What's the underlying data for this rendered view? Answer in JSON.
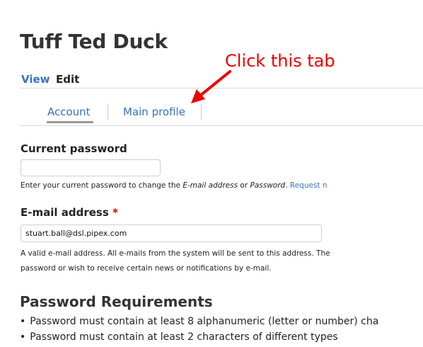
{
  "page": {
    "title": "Tuff Ted Duck"
  },
  "primary_tabs": [
    {
      "label": "View"
    },
    {
      "label": "Edit"
    }
  ],
  "secondary_tabs": [
    {
      "label": "Account"
    },
    {
      "label": "Main profile"
    }
  ],
  "current_password": {
    "label": "Current password",
    "value": "",
    "help_prefix": "Enter your current password to change the ",
    "help_em1": "E-mail address",
    "help_mid": " or ",
    "help_em2": "Password",
    "help_suffix": ". ",
    "help_link": "Request n"
  },
  "email": {
    "label": "E-mail address",
    "required_mark": "*",
    "value": "stuart.ball@dsl.pipex.com",
    "help_line1": "A valid e-mail address. All e-mails from the system will be sent to this address. The",
    "help_line2": "password or wish to receive certain news or notifications by e-mail."
  },
  "password_requirements": {
    "heading": "Password Requirements",
    "items": [
      "Password must contain at least 8 alphanumeric (letter or number) cha",
      "Password must contain at least 2 characters of different types"
    ]
  },
  "annotation": {
    "text": "Click this tab",
    "color": "#ee0000"
  },
  "colors": {
    "link": "#3a73b8",
    "required": "#cc0000"
  }
}
